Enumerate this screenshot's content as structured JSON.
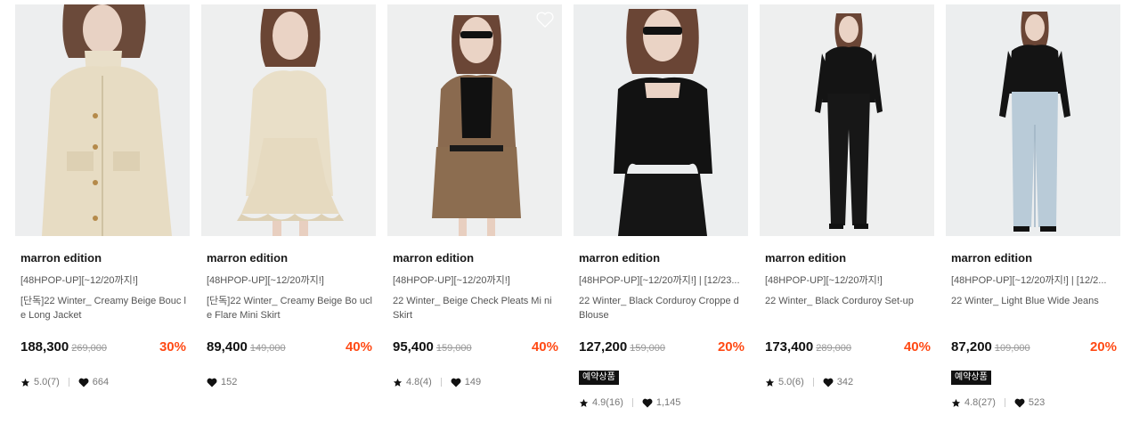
{
  "products": [
    {
      "brand": "marron edition",
      "promo": "[48HPOP-UP][~12/20까지!]",
      "title": "[단독]22 Winter_ Creamy Beige Bouc le Long Jacket",
      "price": "188,300",
      "original_price": "269,000",
      "discount": "30%",
      "badge": "",
      "rating": "5.0(7)",
      "likes": "664",
      "image": "beige-boucle-long-jacket"
    },
    {
      "brand": "marron edition",
      "promo": "[48HPOP-UP][~12/20까지!]",
      "title": "[단독]22 Winter_ Creamy Beige Bo ucle Flare Mini Skirt",
      "price": "89,400",
      "original_price": "149,000",
      "discount": "40%",
      "badge": "",
      "rating": "",
      "likes": "152",
      "image": "beige-boucle-flare-skirt"
    },
    {
      "brand": "marron edition",
      "promo": "[48HPOP-UP][~12/20까지!]",
      "title": "22 Winter_ Beige Check Pleats Mi ni Skirt",
      "price": "95,400",
      "original_price": "159,000",
      "discount": "40%",
      "badge": "",
      "rating": "4.8(4)",
      "likes": "149",
      "image": "check-pleats-skirt"
    },
    {
      "brand": "marron edition",
      "promo": "[48HPOP-UP][~12/20까지!] | [12/23...",
      "title": "22 Winter_ Black Corduroy Croppe d Blouse",
      "price": "127,200",
      "original_price": "159,000",
      "discount": "20%",
      "badge": "예약상품",
      "rating": "4.9(16)",
      "likes": "1,145",
      "image": "black-corduroy-blouse"
    },
    {
      "brand": "marron edition",
      "promo": "[48HPOP-UP][~12/20까지!]",
      "title": "22 Winter_ Black Corduroy Set-up",
      "price": "173,400",
      "original_price": "289,000",
      "discount": "40%",
      "badge": "",
      "rating": "5.0(6)",
      "likes": "342",
      "image": "black-corduroy-setup"
    },
    {
      "brand": "marron edition",
      "promo": "[48HPOP-UP][~12/20까지!] | [12/2...",
      "title": "22 Winter_ Light Blue Wide Jeans",
      "price": "87,200",
      "original_price": "109,000",
      "discount": "20%",
      "badge": "예약상품",
      "rating": "4.8(27)",
      "likes": "523",
      "image": "light-blue-wide-jeans"
    }
  ],
  "icons": {
    "rating": "star-icon",
    "likes": "heart-icon",
    "wishlist": "heart-outline-icon"
  },
  "colors": {
    "discount": "#ff4a15",
    "badge_bg": "#111111",
    "image_bg": "#eceeef"
  }
}
